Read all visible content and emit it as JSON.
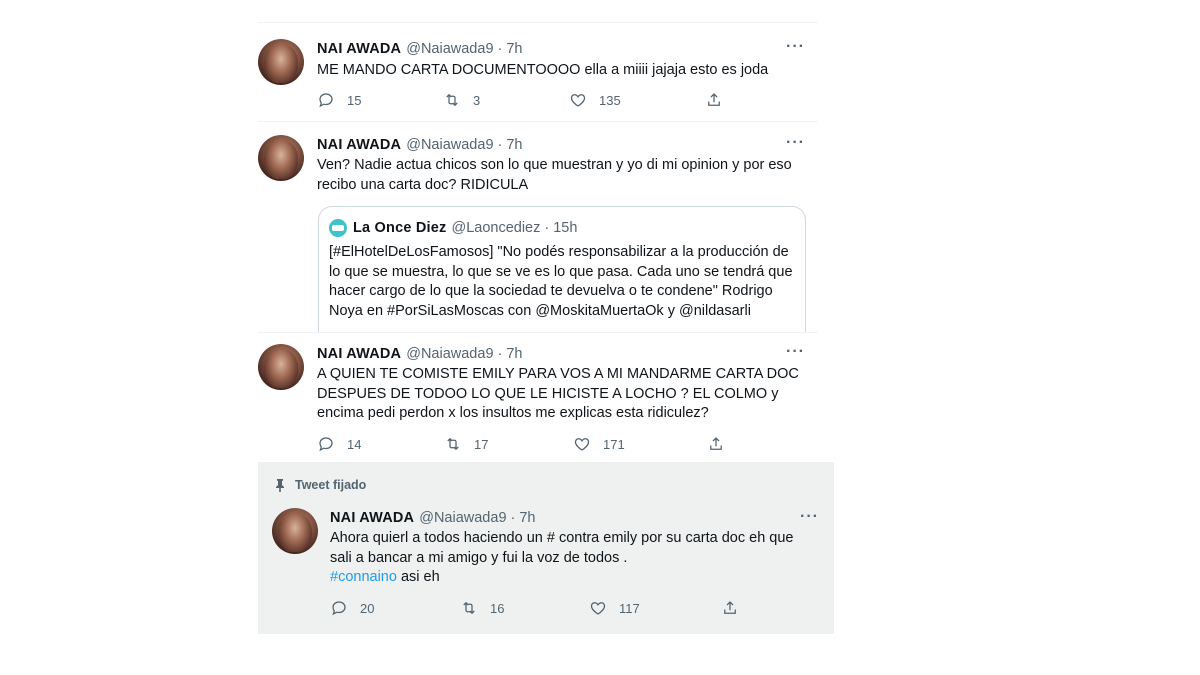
{
  "tweets": [
    {
      "name": "NAI AWADA",
      "handle": "@Naiawada9",
      "time": "7h",
      "text": "ME MANDO CARTA DOCUMENTOOOO ella a miiii jajaja esto es joda",
      "replies": "15",
      "retweets": "3",
      "likes": "135"
    },
    {
      "name": "NAI AWADA",
      "handle": "@Naiawada9",
      "time": "7h",
      "text": "Ven? Nadie actua chicos son lo que muestran y yo di mi opinion y por eso recibo una carta doc? RIDICULA",
      "quote": {
        "name": "La Once Diez",
        "handle": "@Laoncediez",
        "time": "15h",
        "text": "[#ElHotelDeLosFamosos] \"No podés responsabilizar a la producción de lo que se muestra, lo que se ve es lo que pasa. Cada uno se tendrá que hacer cargo de lo que la sociedad te devuelva o te condene\" Rodrigo Noya en #PorSiLasMoscas con @MoskitaMuertaOk y @nildasarli"
      }
    },
    {
      "name": "NAI AWADA",
      "handle": "@Naiawada9",
      "time": "7h",
      "text": "A QUIEN TE COMISTE EMILY PARA VOS A MI MANDARME CARTA DOC DESPUES DE TODOO LO QUE LE HICISTE A LOCHO ? EL COLMO y encima pedi perdon x los insultos me explicas esta ridiculez?",
      "replies": "14",
      "retweets": "17",
      "likes": "171"
    },
    {
      "pinned_label": "Tweet fijado",
      "name": "NAI AWADA",
      "handle": "@Naiawada9",
      "time": "7h",
      "text": "Ahora quierl a todos haciendo un # contra emily por su carta doc eh que sali a bancar a mi amigo y fui la voz de todos .",
      "hashtag": "#connaino",
      "text_after": " asi eh",
      "replies": "20",
      "retweets": "16",
      "likes": "117"
    }
  ],
  "ui": {
    "separator": "·",
    "more": "···",
    "accent": "#1d9bf0",
    "icons": [
      "reply-icon",
      "retweet-icon",
      "like-icon",
      "share-icon",
      "pin-icon",
      "more-icon"
    ]
  }
}
